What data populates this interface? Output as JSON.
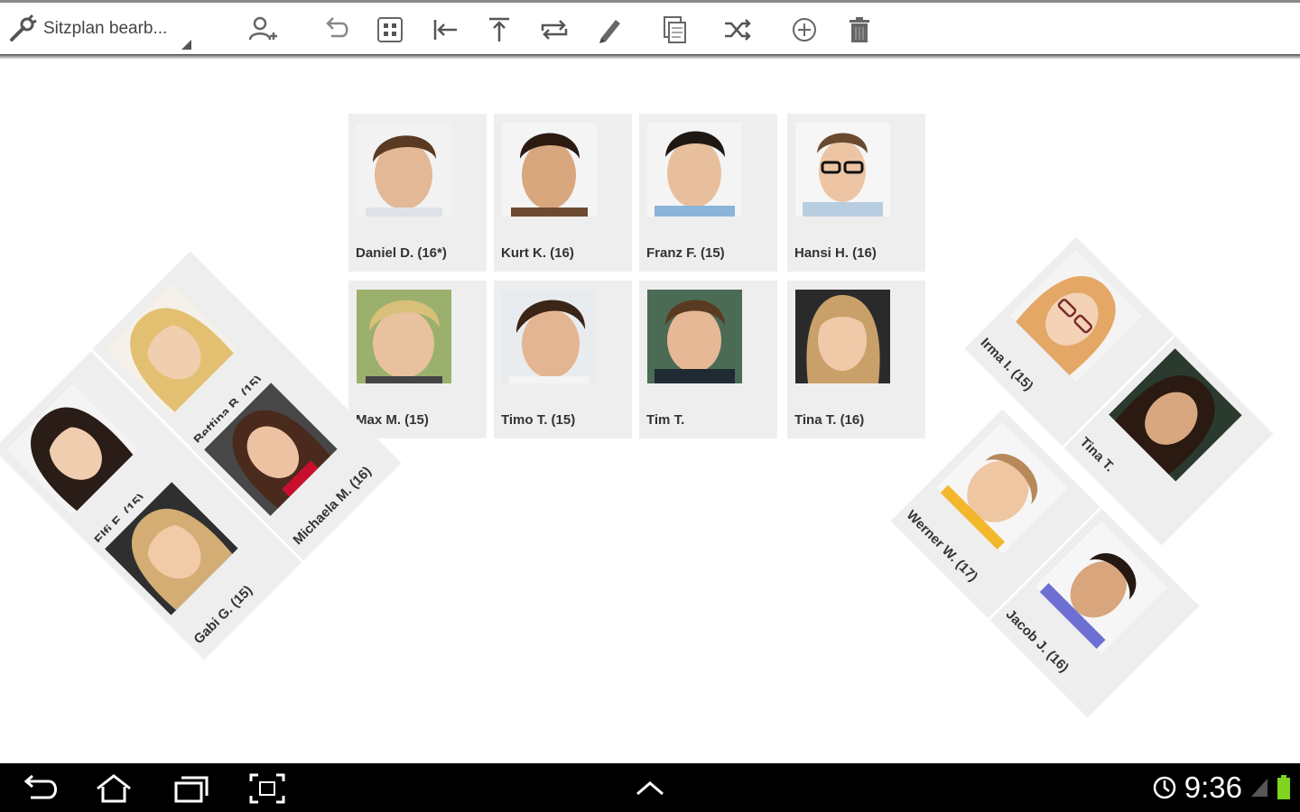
{
  "toolbar": {
    "title": "Sitzplan bearb...",
    "icons": [
      "wrench-icon",
      "add-student-icon",
      "undo-icon",
      "grid-icon",
      "align-left-icon",
      "align-top-icon",
      "swap-icon",
      "edit-pencil-icon",
      "copy-icon",
      "shuffle-icon",
      "add-circle-icon",
      "trash-icon"
    ]
  },
  "students": {
    "daniel": {
      "name": "Daniel D.  (16*)"
    },
    "kurt": {
      "name": "Kurt K.  (16)"
    },
    "franz": {
      "name": "Franz F.  (15)"
    },
    "hansi": {
      "name": "Hansi H.  (16)"
    },
    "max": {
      "name": "Max M.  (15)"
    },
    "timo": {
      "name": "Timo T.  (15)"
    },
    "tim": {
      "name": "Tim T."
    },
    "tina_center": {
      "name": "Tina T.  (16)"
    },
    "bettina": {
      "name": "Bettina B.  (15)"
    },
    "elfi": {
      "name": "Elfi E.  (15)"
    },
    "michaela": {
      "name": "Michaela M.  (16)"
    },
    "gabi": {
      "name": "Gabi G.  (15)"
    },
    "irma": {
      "name": "Irma I.  (15)"
    },
    "tina_right": {
      "name": "Tina T."
    },
    "werner": {
      "name": "Werner W.  (17)"
    },
    "jacob": {
      "name": "Jacob J.  (16)"
    }
  },
  "statusbar": {
    "time": "9:36",
    "nav_icons": [
      "back-icon",
      "home-icon",
      "recent-apps-icon",
      "screenshot-icon",
      "expand-up-icon"
    ]
  },
  "colors": {
    "card_bg": "#eeeeee",
    "toolbar_bg": "#ffffff",
    "navbar_bg": "#000000",
    "battery": "#7fd321"
  }
}
